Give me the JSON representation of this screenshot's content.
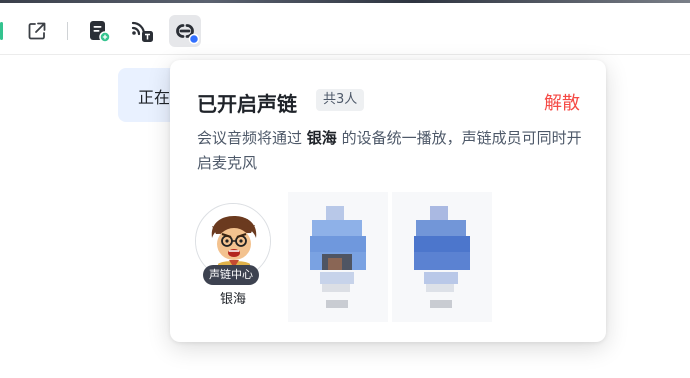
{
  "toolbar": {
    "icons": [
      "open-external-icon",
      "document-badge-icon",
      "cast-screen-icon",
      "voice-link-icon"
    ]
  },
  "background": {
    "chip_text": "正在"
  },
  "popover": {
    "title": "已开启声链",
    "count": "共3人",
    "action": "解散",
    "desc_prefix": "会议音频将通过 ",
    "desc_name": "银海",
    "desc_suffix": " 的设备统一播放，声链成员可同时开启麦克风",
    "members": [
      {
        "name": "银海",
        "tag": "声链中心"
      }
    ]
  },
  "colors": {
    "accent_red": "#f54a45",
    "accent_blue": "#3370ff",
    "accent_green": "#34c38f"
  }
}
